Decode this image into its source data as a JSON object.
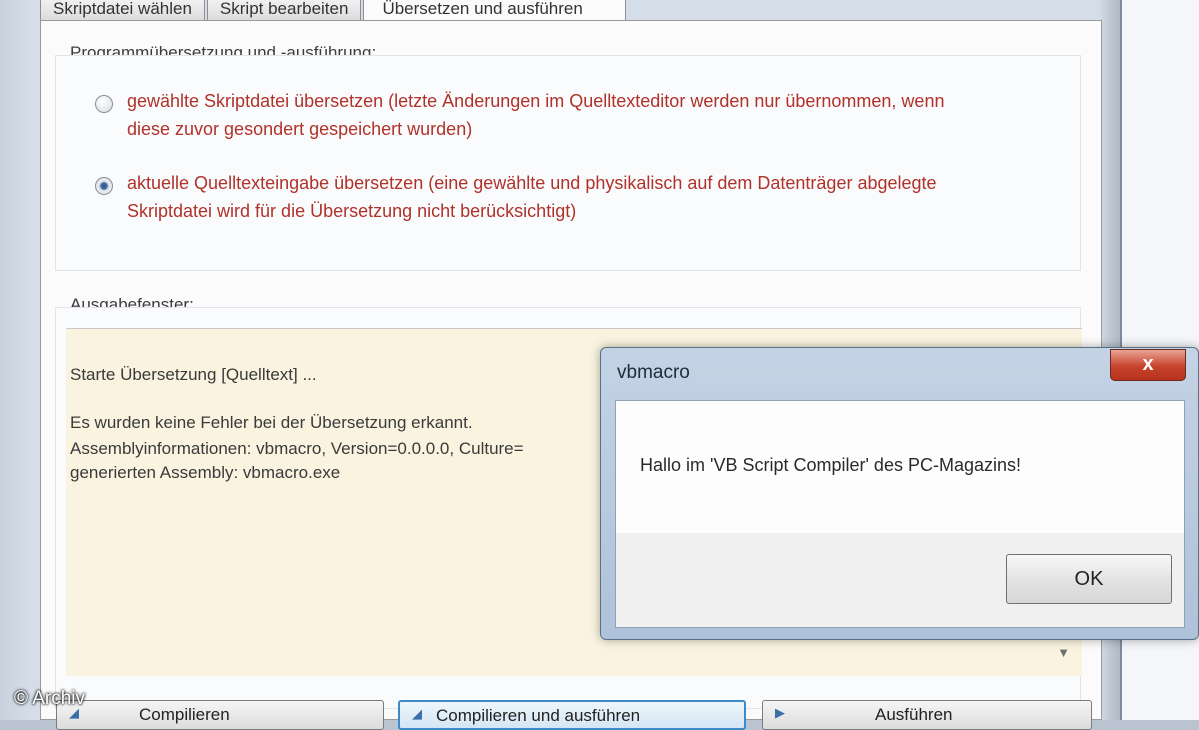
{
  "tabs": [
    {
      "label": "Skriptdatei wählen"
    },
    {
      "label": "Skript bearbeiten"
    },
    {
      "label": "Übersetzen und ausführen"
    }
  ],
  "compile_group": {
    "label": "Programmübersetzung und -ausführung:",
    "options": [
      {
        "line1": "gewählte Skriptdatei übersetzen (letzte Änderungen im Quelltexteditor werden nur übernommen, wenn",
        "line2": "diese zuvor gesondert gespeichert wurden)",
        "checked": false
      },
      {
        "line1": "aktuelle Quelltexteingabe übersetzen (eine gewählte und physikalisch auf dem Datenträger abgelegte",
        "line2": "Skriptdatei wird für die Übersetzung nicht berücksichtigt)",
        "checked": true
      }
    ]
  },
  "output": {
    "label": "Ausgabefenster:",
    "lines": [
      "Starte Übersetzung [Quelltext] ...",
      "Es wurden keine Fehler bei der Übersetzung erkannt.",
      "Assemblyinformationen: vbmacro, Version=0.0.0.0, Culture=",
      "generierten Assembly: vbmacro.exe"
    ]
  },
  "buttons": {
    "compile": "Compilieren",
    "compile_run": "Compilieren und ausführen",
    "run": "Ausführen"
  },
  "dialog": {
    "title": "vbmacro",
    "close": "x",
    "message": "Hallo im 'VB Script Compiler' des PC-Magazins!",
    "ok": "OK"
  },
  "copyright": "© Archiv",
  "colors": {
    "option_text": "#b0322a",
    "output_bg": "#f9f3e0",
    "close_button": "#c7432b"
  }
}
